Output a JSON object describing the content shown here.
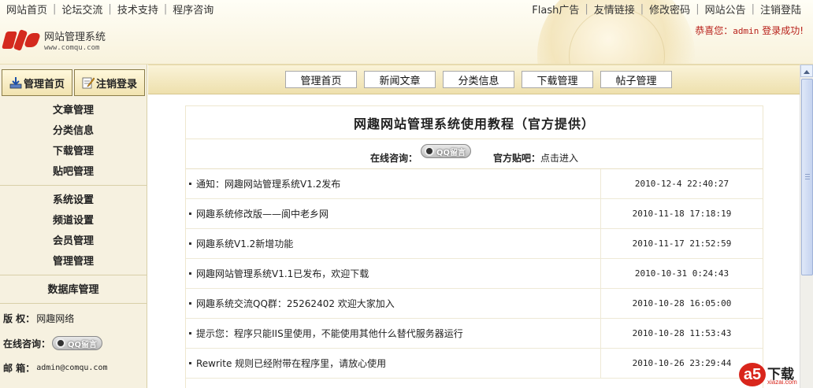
{
  "header": {
    "left_links": [
      "网站首页",
      "论坛交流",
      "技术支持",
      "程序咨询"
    ],
    "right_links": [
      "Flash广告",
      "友情链接",
      "修改密码",
      "网站公告",
      "注销登陆"
    ],
    "logo_title": "网站管理系统",
    "logo_url": "www.comqu.com",
    "welcome_prefix": "恭喜您：",
    "welcome_user": "admin",
    "welcome_suffix": "登录成功!"
  },
  "sidebar": {
    "tabs": [
      "管理首页",
      "注销登录"
    ],
    "groups": [
      [
        "文章管理",
        "分类信息",
        "下载管理",
        "贴吧管理"
      ],
      [
        "系统设置",
        "频道设置",
        "会员管理",
        "管理管理"
      ],
      [
        "数据库管理"
      ]
    ],
    "copyright_label": "版  权：",
    "copyright_value": "网趣网络",
    "consult_label": "在线咨询：",
    "email_label": "邮  箱：",
    "email_value": "admin@comqu.com"
  },
  "qq_badge": "QQ留言",
  "main": {
    "tabs": [
      "管理首页",
      "新闻文章",
      "分类信息",
      "下载管理",
      "帖子管理"
    ],
    "title": "网趣网站管理系统使用教程（官方提供）",
    "consult_label": "在线咨询：",
    "forum_label": "官方贴吧：",
    "forum_link": "点击进入",
    "news": [
      {
        "title": "通知：网趣网站管理系统V1.2发布",
        "date": "2010-12-4 22:40:27"
      },
      {
        "title": "网趣系统修改版——阆中老乡网",
        "date": "2010-11-18 17:18:19"
      },
      {
        "title": "网趣系统V1.2新增功能",
        "date": "2010-11-17 21:52:59"
      },
      {
        "title": "网趣网站管理系统V1.1已发布，欢迎下载",
        "date": "2010-10-31 0:24:43"
      },
      {
        "title": "网趣系统交流QQ群：25262402 欢迎大家加入",
        "date": "2010-10-28 16:05:00"
      },
      {
        "title": "提示您：程序只能IIS里使用，不能使用其他什么替代服务器运行",
        "date": "2010-10-28 11:53:43"
      },
      {
        "title": "Rewrite 规则已经附带在程序里，请放心使用",
        "date": "2010-10-26 23:29:44"
      }
    ]
  },
  "watermark": {
    "mark": "a5",
    "cn": "下载",
    "url": "xiazai.com"
  },
  "colors": {
    "accent_red": "#b8201a",
    "sidebar_bg": "#f6f1e0",
    "tabbar_bg": "#eee0ad"
  },
  "icons": {
    "admin_home": "download-arrow-icon",
    "logout": "pencil-note-icon",
    "qq": "qq-penguin-icon"
  }
}
